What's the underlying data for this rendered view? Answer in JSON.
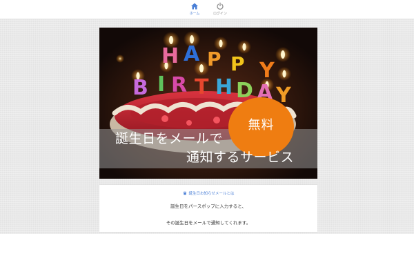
{
  "nav": {
    "items": [
      {
        "label": "ホーム",
        "icon": "home-icon",
        "active": true
      },
      {
        "label": "ログイン",
        "icon": "power-icon",
        "active": false
      }
    ]
  },
  "hero": {
    "candle_letters": [
      "H",
      "A",
      "P",
      "P",
      "Y",
      "B",
      "I",
      "R",
      "T",
      "H",
      "D",
      "A",
      "Y"
    ],
    "headline_line1": "誕生日をメールで",
    "headline_line2": "通知するサービス",
    "badge": "無料"
  },
  "info": {
    "heading": "誕生日お知らせメールとは",
    "heading_icon": "book-icon",
    "line1": "誕生日をパースポップに入力すると、",
    "line2": "その誕生日をメールで通知してくれます。"
  },
  "colors": {
    "accent": "#4a7fd6",
    "badge": "#ef7d11",
    "page_background": "#e9e9e9"
  }
}
